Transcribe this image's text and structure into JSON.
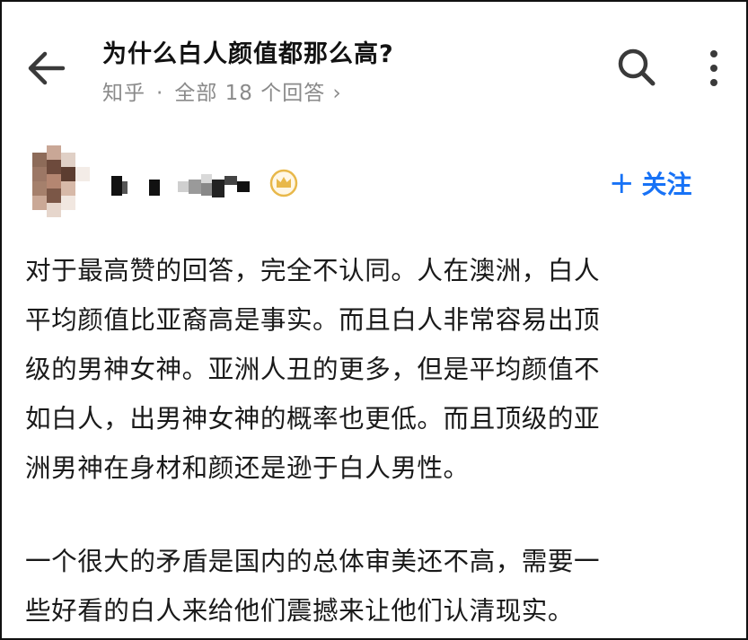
{
  "header": {
    "title": "为什么白人颜值都那么高?",
    "source": "知乎",
    "separator": "·",
    "answers_link": "全部 18 个回答 ›"
  },
  "icons": {
    "back": "arrow-left-icon",
    "search": "search-icon",
    "more": "more-vertical-icon",
    "badge": "crown-badge-icon"
  },
  "author": {
    "follow_plus": "+",
    "follow_label": "关注"
  },
  "answer": {
    "paragraph1": [
      "对于最高赞的回答，完全不认同。人在澳洲，白人",
      "平均颜值比亚裔高是事实。而且白人非常容易出顶",
      "级的男神女神。亚洲人丑的更多，但是平均颜值不",
      "如白人，出男神女神的概率也更低。而且顶级的亚",
      "洲男神在身材和颜还是逊于白人男性。"
    ],
    "paragraph2": [
      "一个很大的矛盾是国内的总体审美还不高，需要一",
      "些好看的白人来给他们震撼来让他们认清现实。"
    ]
  },
  "colors": {
    "accent": "#1772f6",
    "text": "#1a1a1a",
    "muted": "#8a8a8a",
    "badge_gold": "#e8b84a"
  }
}
